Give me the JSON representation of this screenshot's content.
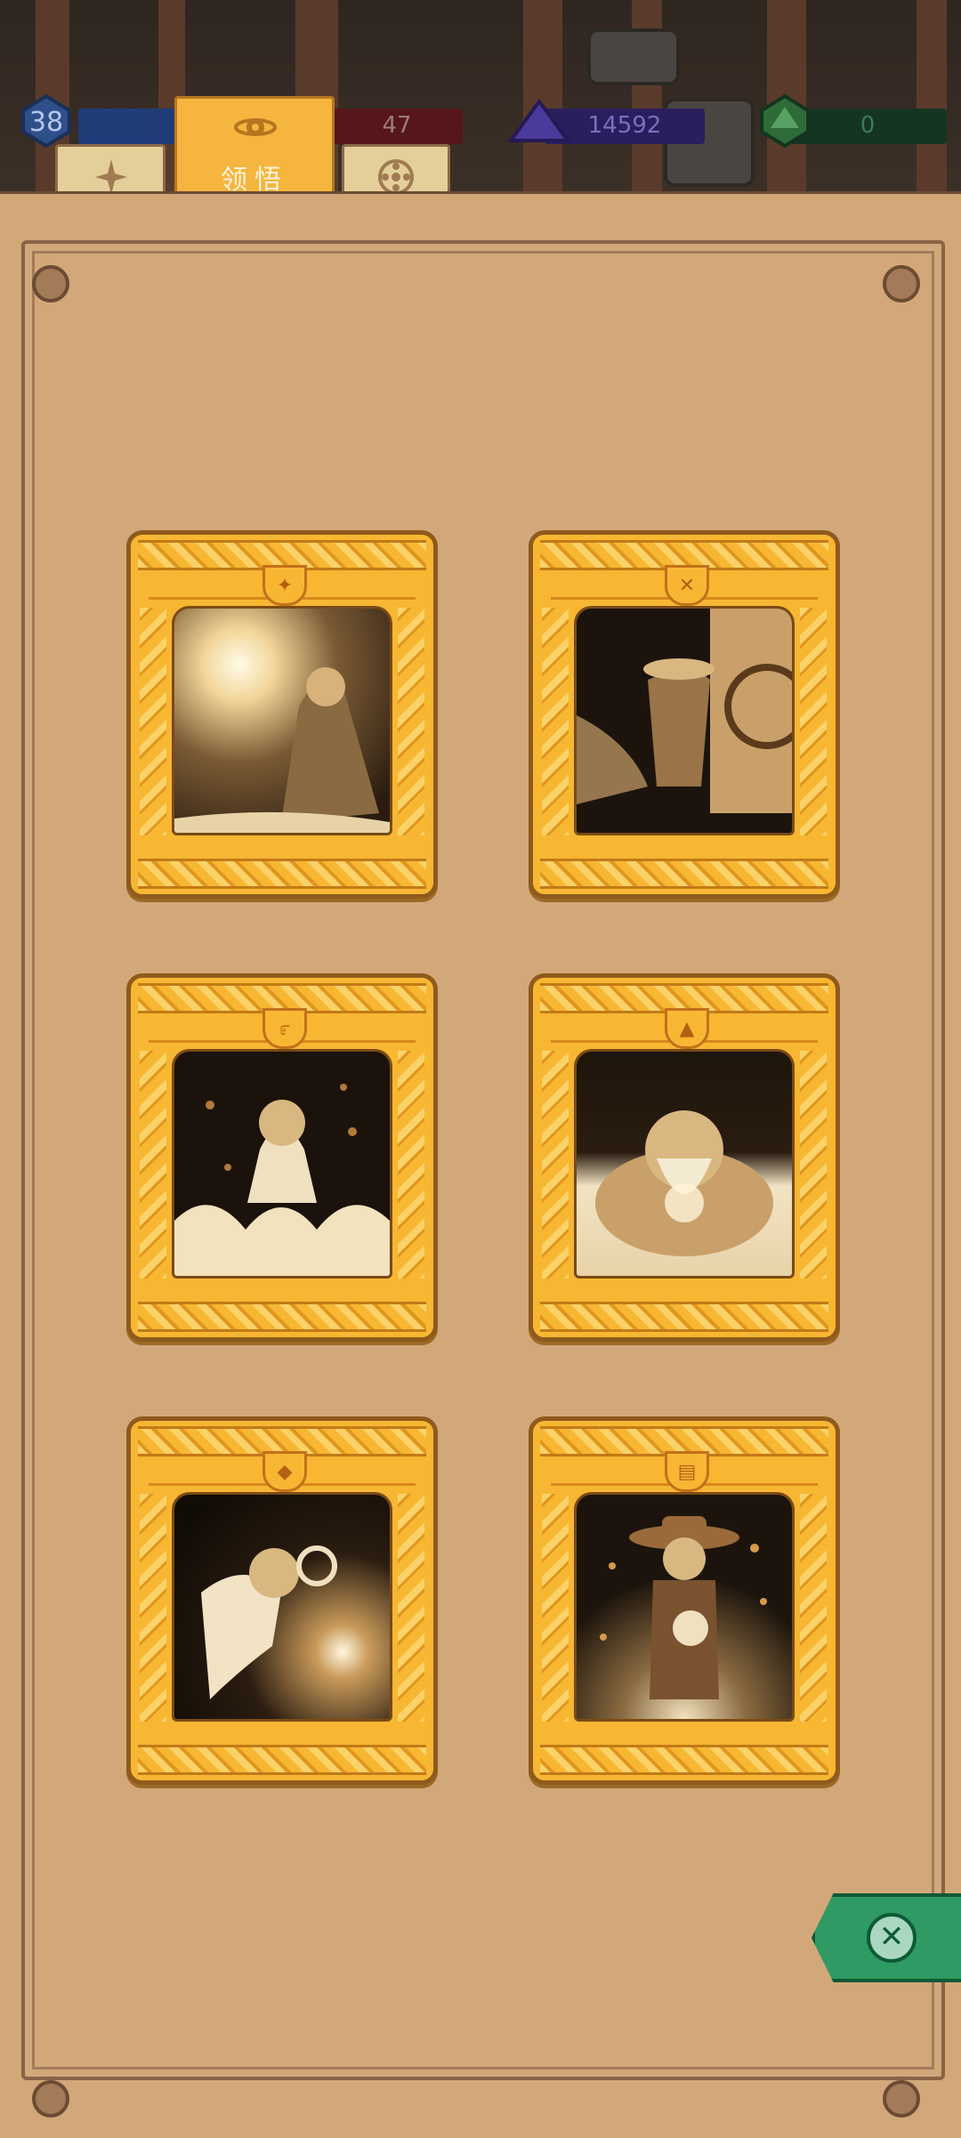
{
  "header": {
    "level": "38",
    "red_value": "47",
    "purple_value": "14592",
    "green_value": "0"
  },
  "tabs": [
    {
      "label": "",
      "icon": "compass-star-icon",
      "active": false
    },
    {
      "label": "领悟",
      "icon": "eye-planet-icon",
      "active": true
    },
    {
      "label": "",
      "icon": "wheel-icon",
      "active": false
    }
  ],
  "cards": [
    {
      "name": "light-orb-card",
      "emblem": "shield-icon",
      "emblem_glyph": "✦",
      "scene": "glowing orb and cloaked figure"
    },
    {
      "name": "door-card",
      "emblem": "crossed-arrows-icon",
      "emblem_glyph": "✕",
      "scene": "figure at circular door"
    },
    {
      "name": "flame-dancer-card",
      "emblem": "swirl-icon",
      "emblem_glyph": "೯",
      "scene": "girl among flames"
    },
    {
      "name": "bearded-sage-card",
      "emblem": "triangle-icon",
      "emblem_glyph": "▲",
      "scene": "bearded hermit meditating"
    },
    {
      "name": "floating-sleeper-card",
      "emblem": "diamond-icon",
      "emblem_glyph": "◆",
      "scene": "sleeper with spiral orb"
    },
    {
      "name": "cowboy-card",
      "emblem": "bars-icon",
      "emblem_glyph": "▤",
      "scene": "cowboy with lantern"
    }
  ],
  "colors": {
    "parchment": "#d2a77a",
    "card_gold": "#f7b733",
    "close_green": "#2f9a64"
  }
}
